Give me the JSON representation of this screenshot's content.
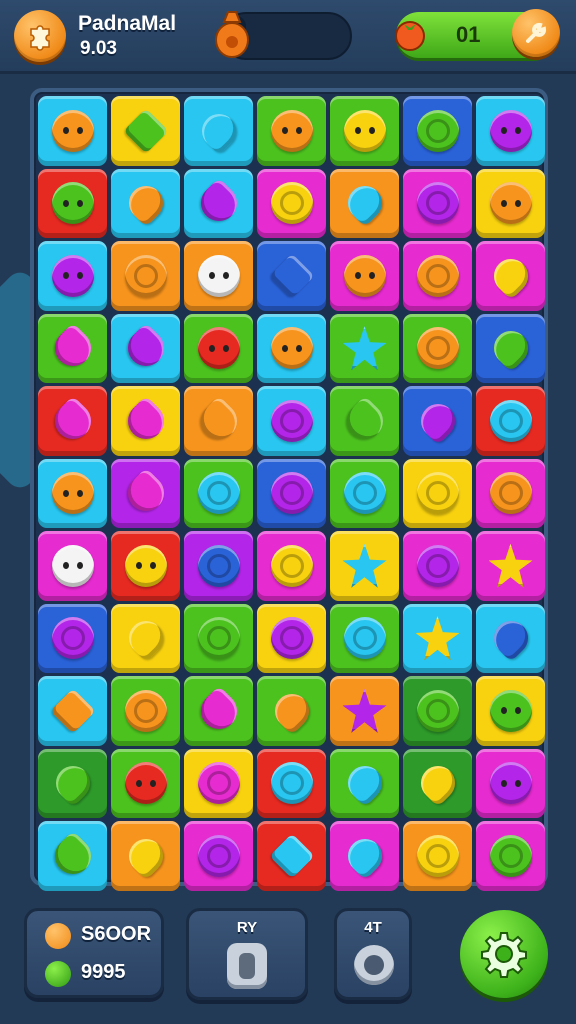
{
  "header": {
    "title": "PadnaMal",
    "subtitle": "9.03",
    "lives_value": "01"
  },
  "colors": {
    "orange": "#f7941d",
    "green": "#4cc21f",
    "cyan": "#28c6f0",
    "blue": "#2a62d8",
    "purple": "#b325e8",
    "magenta": "#e62bd0",
    "red": "#e62a22",
    "yellow": "#f8d20f",
    "dark_green": "#2d9a2a"
  },
  "board": {
    "rows": [
      [
        [
          "cyan",
          "orange",
          "face"
        ],
        [
          "yellow",
          "green",
          "gem"
        ],
        [
          "cyan",
          "cyan",
          "drop"
        ],
        [
          "green",
          "orange",
          "face"
        ],
        [
          "green",
          "yellow",
          "face"
        ],
        [
          "blue",
          "green",
          "ring"
        ],
        [
          "cyan",
          "purple",
          "face"
        ]
      ],
      [
        [
          "red",
          "green",
          "face"
        ],
        [
          "cyan",
          "orange",
          "drop"
        ],
        [
          "cyan",
          "purple",
          "heart"
        ],
        [
          "magenta",
          "yellow",
          "ring"
        ],
        [
          "orange",
          "cyan",
          "drop"
        ],
        [
          "magenta",
          "purple",
          "ring"
        ],
        [
          "yellow",
          "orange",
          "face"
        ]
      ],
      [
        [
          "cyan",
          "purple",
          "face"
        ],
        [
          "orange",
          "orange",
          "ring"
        ],
        [
          "orange",
          "white",
          "face"
        ],
        [
          "blue",
          "blue",
          "gem"
        ],
        [
          "magenta",
          "orange",
          "face"
        ],
        [
          "magenta",
          "orange",
          "ring"
        ],
        [
          "magenta",
          "yellow",
          "drop"
        ]
      ],
      [
        [
          "green",
          "magenta",
          "heart"
        ],
        [
          "cyan",
          "purple",
          "heart"
        ],
        [
          "green",
          "red",
          "face"
        ],
        [
          "cyan",
          "orange",
          "face"
        ],
        [
          "green",
          "cyan",
          "star"
        ],
        [
          "green",
          "orange",
          "ring"
        ],
        [
          "blue",
          "green",
          "drop"
        ]
      ],
      [
        [
          "red",
          "magenta",
          "heart"
        ],
        [
          "yellow",
          "magenta",
          "heart"
        ],
        [
          "orange",
          "orange",
          "heart"
        ],
        [
          "cyan",
          "purple",
          "ring"
        ],
        [
          "green",
          "green",
          "heart"
        ],
        [
          "blue",
          "purple",
          "drop"
        ],
        [
          "red",
          "cyan",
          "ring"
        ]
      ],
      [
        [
          "cyan",
          "orange",
          "face"
        ],
        [
          "purple",
          "magenta",
          "heart"
        ],
        [
          "green",
          "cyan",
          "ring"
        ],
        [
          "blue",
          "purple",
          "ring"
        ],
        [
          "green",
          "cyan",
          "ring"
        ],
        [
          "yellow",
          "yellow",
          "ring"
        ],
        [
          "magenta",
          "orange",
          "ring"
        ]
      ],
      [
        [
          "magenta",
          "white",
          "face"
        ],
        [
          "red",
          "yellow",
          "face"
        ],
        [
          "purple",
          "blue",
          "ring"
        ],
        [
          "magenta",
          "yellow",
          "ring"
        ],
        [
          "yellow",
          "cyan",
          "star"
        ],
        [
          "magenta",
          "purple",
          "ring"
        ],
        [
          "magenta",
          "yellow",
          "star"
        ]
      ],
      [
        [
          "blue",
          "purple",
          "ring"
        ],
        [
          "yellow",
          "yellow",
          "drop"
        ],
        [
          "green",
          "green",
          "ring"
        ],
        [
          "yellow",
          "purple",
          "ring"
        ],
        [
          "green",
          "cyan",
          "ring"
        ],
        [
          "cyan",
          "yellow",
          "star"
        ],
        [
          "cyan",
          "blue",
          "drop"
        ]
      ],
      [
        [
          "cyan",
          "orange",
          "gem"
        ],
        [
          "green",
          "orange",
          "ring"
        ],
        [
          "green",
          "magenta",
          "heart"
        ],
        [
          "green",
          "orange",
          "drop"
        ],
        [
          "orange",
          "purple",
          "star"
        ],
        [
          "dark_green",
          "green",
          "ring"
        ],
        [
          "yellow",
          "green",
          "face"
        ]
      ],
      [
        [
          "dark_green",
          "green",
          "drop"
        ],
        [
          "green",
          "red",
          "face"
        ],
        [
          "yellow",
          "magenta",
          "ring"
        ],
        [
          "red",
          "cyan",
          "ring"
        ],
        [
          "green",
          "cyan",
          "drop"
        ],
        [
          "dark_green",
          "yellow",
          "drop"
        ],
        [
          "magenta",
          "purple",
          "face"
        ]
      ],
      [
        [
          "cyan",
          "green",
          "heart"
        ],
        [
          "orange",
          "yellow",
          "drop"
        ],
        [
          "magenta",
          "purple",
          "ring"
        ],
        [
          "red",
          "cyan",
          "gem"
        ],
        [
          "magenta",
          "cyan",
          "drop"
        ],
        [
          "orange",
          "yellow",
          "ring"
        ],
        [
          "magenta",
          "green",
          "ring"
        ]
      ]
    ]
  },
  "footer": {
    "stat_1": "S6OOR",
    "stat_2": "9995",
    "booster_1_label": "RY",
    "booster_2_label": "4T"
  }
}
